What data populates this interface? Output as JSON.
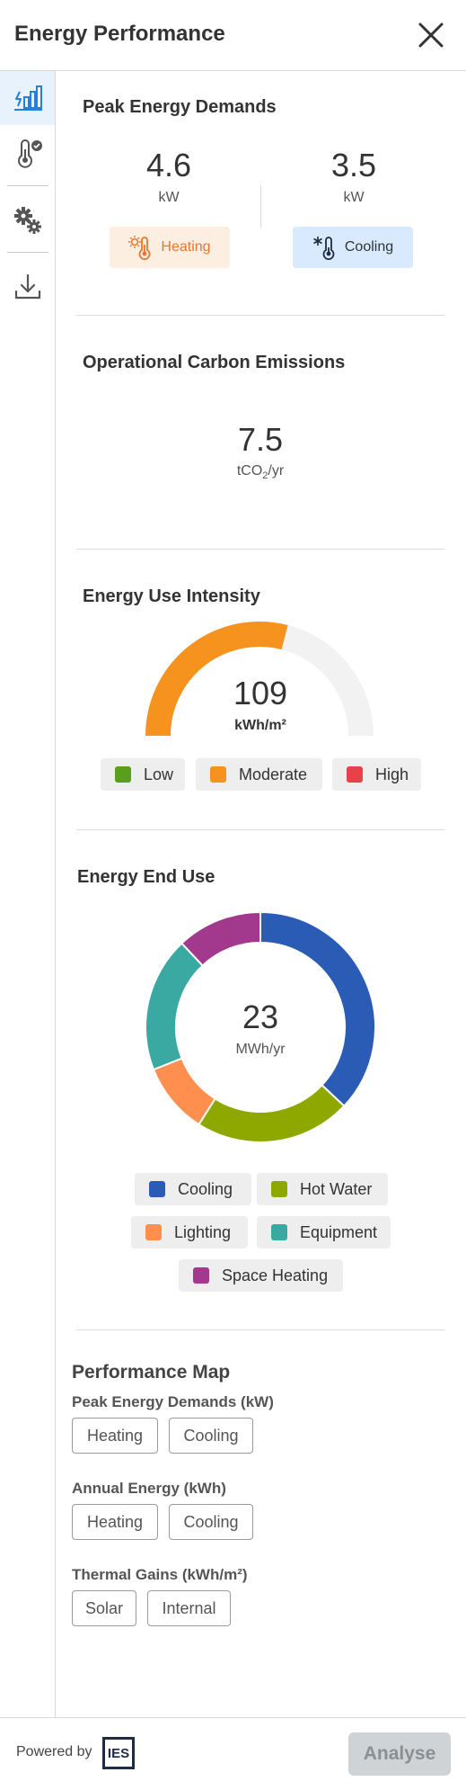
{
  "header": {
    "title": "Energy Performance",
    "close_icon": "close-icon"
  },
  "sidebar": {
    "items": [
      {
        "icon": "energy-chart-icon",
        "active": true
      },
      {
        "icon": "thermometer-check-icon",
        "active": false
      },
      {
        "icon": "gears-icon",
        "active": false
      },
      {
        "icon": "download-icon",
        "active": false
      }
    ]
  },
  "peak": {
    "title": "Peak Energy Demands",
    "heating": {
      "value": "4.6",
      "unit": "kW",
      "label": "Heating"
    },
    "cooling": {
      "value": "3.5",
      "unit": "kW",
      "label": "Cooling"
    }
  },
  "carbon": {
    "title": "Operational Carbon Emissions",
    "value": "7.5",
    "unit_prefix": "tCO",
    "unit_sub": "2",
    "unit_suffix": "/yr"
  },
  "eui": {
    "title": "Energy Use Intensity",
    "value": "109",
    "unit": "kWh/m²",
    "gauge_fraction": 0.58,
    "gauge_color": "#f6921e",
    "track_color": "#f2f2f2",
    "legend": [
      {
        "label": "Low",
        "color": "#5a9e1b"
      },
      {
        "label": "Moderate",
        "color": "#f6921e"
      },
      {
        "label": "High",
        "color": "#e8414a"
      }
    ]
  },
  "enduse": {
    "title": "Energy End Use",
    "value": "23",
    "unit": "MWh/yr",
    "legend": [
      {
        "label": "Cooling",
        "color": "#2a5bb5"
      },
      {
        "label": "Hot Water",
        "color": "#8fa800"
      },
      {
        "label": "Lighting",
        "color": "#ff8f4f"
      },
      {
        "label": "Equipment",
        "color": "#3aa9a2"
      },
      {
        "label": "Space Heating",
        "color": "#a3398c"
      }
    ]
  },
  "chart_data": {
    "type": "pie",
    "title": "Energy End Use",
    "center_value": "23",
    "center_unit": "MWh/yr",
    "categories": [
      "Cooling",
      "Hot Water",
      "Lighting",
      "Equipment",
      "Space Heating"
    ],
    "values": [
      37,
      22,
      10,
      19,
      12
    ],
    "colors": [
      "#2a5bb5",
      "#8fa800",
      "#ff8f4f",
      "#3aa9a2",
      "#a3398c"
    ]
  },
  "perfmap": {
    "title": "Performance Map",
    "groups": [
      {
        "label": "Peak Energy Demands (kW)",
        "buttons": [
          "Heating",
          "Cooling"
        ]
      },
      {
        "label": "Annual Energy (kWh)",
        "buttons": [
          "Heating",
          "Cooling"
        ]
      },
      {
        "label": "Thermal Gains (kWh/m²)",
        "buttons": [
          "Solar",
          "Internal"
        ]
      }
    ]
  },
  "footer": {
    "powered_by": "Powered by",
    "logo_text": "IES",
    "analyse_label": "Analyse"
  }
}
